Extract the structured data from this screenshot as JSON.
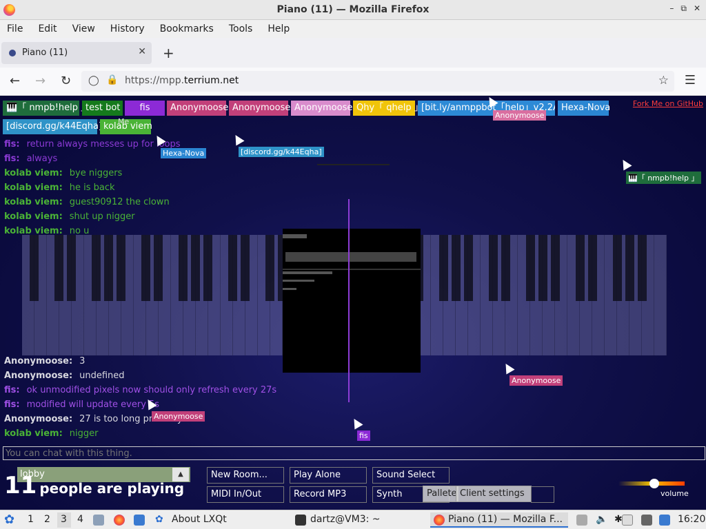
{
  "window": {
    "title": "Piano (11) — Mozilla Firefox"
  },
  "menu": [
    "File",
    "Edit",
    "View",
    "History",
    "Bookmarks",
    "Tools",
    "Help"
  ],
  "tab": {
    "label": "Piano (11)"
  },
  "url": {
    "prefix": "https://mpp.",
    "domain": "terrium.net"
  },
  "userlist": [
    {
      "name": "🎹「 nmpb!help 」",
      "color": "#1f6d3c"
    },
    {
      "name": "test bot",
      "color": "#157a1c"
    },
    {
      "name": "fis",
      "color": "#8c2ad6"
    },
    {
      "name": "Anonymoose",
      "color": "#c2407a"
    },
    {
      "name": "Anonymoose",
      "color": "#c2407a"
    },
    {
      "name": "Anonymoose",
      "color": "#d98ccc"
    },
    {
      "name": "Qhy「 qhelp 」",
      "color": "#f0c40a"
    },
    {
      "name": "[bit.ly/anmppbot「help」v2.2A]",
      "color": "#2d8ad6"
    },
    {
      "name": "Hexa-Nova",
      "color": "#2b86d2"
    },
    {
      "name": "[discord.gg/k44Eqha]",
      "color": "#2f93c8"
    },
    {
      "name": "kolab viem",
      "color": "#4ab336"
    }
  ],
  "fork_link": "Fork Me on GitHub",
  "chat": [
    {
      "nick": "fis:",
      "msg": "return always messes up for loops",
      "color": "#8c3ad6"
    },
    {
      "nick": "fis:",
      "msg": "always",
      "color": "#8c3ad6"
    },
    {
      "nick": "kolab viem:",
      "msg": "bye niggers",
      "color": "#4ab336"
    },
    {
      "nick": "kolab viem:",
      "msg": "he is back",
      "color": "#4ab336"
    },
    {
      "nick": "kolab viem:",
      "msg": "guest90912 the clown",
      "color": "#4ab336"
    },
    {
      "nick": "kolab viem:",
      "msg": "shut up nigger",
      "color": "#4ab336"
    },
    {
      "nick": "kolab viem:",
      "msg": "no u",
      "color": "#4ab336"
    },
    {
      "nick": "Anonymoose:",
      "msg": "3",
      "color": "#d9d9e0"
    },
    {
      "nick": "Anonymoose:",
      "msg": "undefined",
      "color": "#d9d9e0"
    },
    {
      "nick": "fis:",
      "msg": "ok unmodified pixels now should only refresh every 27s",
      "color": "#a050e6"
    },
    {
      "nick": "fis:",
      "msg": "modified will update every 5s",
      "color": "#a050e6"
    },
    {
      "nick": "Anonymoose:",
      "msg": "27 is too long probably",
      "color": "#d9d9e0"
    },
    {
      "nick": "kolab viem:",
      "msg": "nigger",
      "color": "#4ab336"
    }
  ],
  "cursors": [
    {
      "label": "Anonymoose",
      "color": "#d96fa0"
    },
    {
      "label": "Hexa-Nova",
      "color": "#2b86d2"
    },
    {
      "label": "[discord.gg/k44Eqha]",
      "color": "#2f93c8"
    },
    {
      "label": "🎹「 nmpb!help 」",
      "color": "#1f6d3c"
    },
    {
      "label": "Anonymoose",
      "color": "#c2407a"
    },
    {
      "label": "Anonymoose",
      "color": "#c2407a"
    },
    {
      "label": "fis",
      "color": "#8c2ad6"
    },
    {
      "label": "Me",
      "color": "transparent"
    }
  ],
  "chat_placeholder": "You can chat with this thing.",
  "room": {
    "name": "lobby"
  },
  "people": {
    "count": "11",
    "text": "people are playing"
  },
  "buttons": {
    "new_room": "New Room...",
    "play_alone": "Play Alone",
    "sound_select": "Sound Select",
    "midi": "MIDI In/Out",
    "record": "Record MP3",
    "synth": "Synth",
    "pallete": "Pallete",
    "client_settings": "Client settings"
  },
  "volume": {
    "label": "volume",
    "level": 0.55
  },
  "taskbar": {
    "desktops": [
      "1",
      "2",
      "3",
      "4"
    ],
    "about": "About LXQt",
    "terminal": "dartz@VM3: ~",
    "firefox": "Piano (11) — Mozilla F...",
    "clock": "16:20"
  }
}
